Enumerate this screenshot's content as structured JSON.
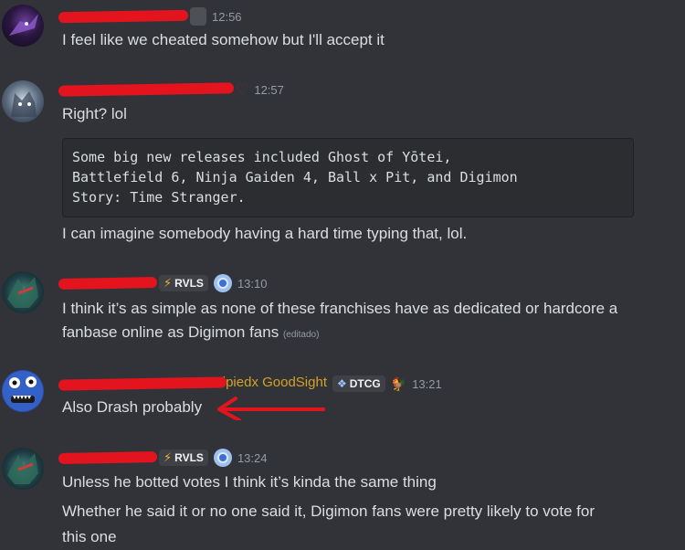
{
  "messages": [
    {
      "time": "12:56",
      "lines": [
        "I feel like we cheated somehow but I'll accept it"
      ]
    },
    {
      "time": "12:57",
      "lines": [
        "Right? lol"
      ],
      "code": "Some big new releases included Ghost of Yōtei,\nBattlefield 6, Ninja Gaiden 4, Ball x Pit, and Digimon\nStory: Time Stranger.",
      "after": "I can imagine somebody having a hard time typing that, lol."
    },
    {
      "tag": "RVLS",
      "time": "13:10",
      "lines": [
        "I think it’s as simple as none of these franchises have as dedicated or hardcore a",
        "fanbase online as Digimon fans"
      ],
      "edited": "(editado)"
    },
    {
      "name_visible": "tipiedx GoodSight",
      "tag": "DTCG",
      "time": "13:21",
      "lines": [
        "Also Drash probably"
      ]
    },
    {
      "tag": "RVLS",
      "time": "13:24",
      "lines": [
        "Unless he botted votes I think it’s kinda the same thing",
        "Whether he said it or no one said it, Digimon fans were pretty likely to vote for",
        "this one"
      ]
    }
  ],
  "colors": {
    "background": "#323339",
    "text": "#dbdee1",
    "timestamp": "#949ba4",
    "redaction": "#e4141f",
    "username": "#e6497a"
  }
}
